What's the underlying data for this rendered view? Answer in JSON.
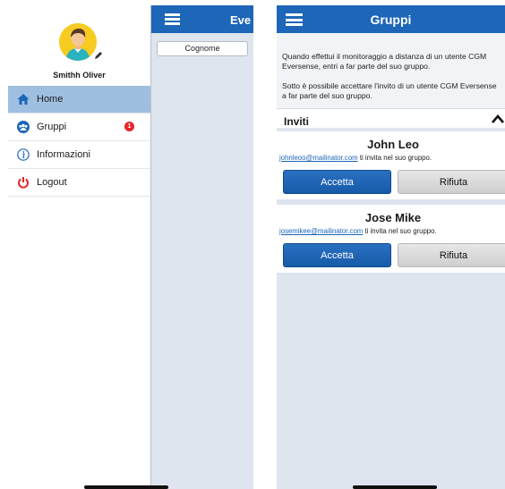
{
  "left_screen": {
    "background_header": {
      "title": "Eve",
      "chip_label": "Cognome"
    },
    "drawer": {
      "user_name": "Smithh Oliver",
      "menu": [
        {
          "label": "Home",
          "icon": "home-icon",
          "active": true
        },
        {
          "label": "Gruppi",
          "icon": "group-icon",
          "badge": "1"
        },
        {
          "label": "Informazioni",
          "icon": "info-icon"
        },
        {
          "label": "Logout",
          "icon": "power-icon"
        }
      ]
    }
  },
  "right_screen": {
    "header": {
      "title": "Gruppi"
    },
    "info": {
      "paragraph_1": "Quando effettui il monitoraggio a distanza di un utente CGM Eversense, entri a far parte del suo gruppo.",
      "paragraph_2": "Sotto è possibile accettare l'invito di un utente CGM Eversense a far parte del suo gruppo."
    },
    "section": {
      "title": "Inviti"
    },
    "invites": [
      {
        "name": "John Leo",
        "email": "johnleoo@mailinator.com",
        "suffix": " ti invita nel suo gruppo.",
        "accept_label": "Accetta",
        "decline_label": "Rifiuta"
      },
      {
        "name": "Jose Mike",
        "email": "josemikee@mailinator.com",
        "suffix": " ti invita nel suo gruppo.",
        "accept_label": "Accetta",
        "decline_label": "Rifiuta"
      }
    ]
  },
  "colors": {
    "primary_blue": "#1d66b8",
    "active_menu": "#9fbfe0",
    "badge_red": "#e8262b",
    "avatar_yellow": "#f6cc22"
  }
}
